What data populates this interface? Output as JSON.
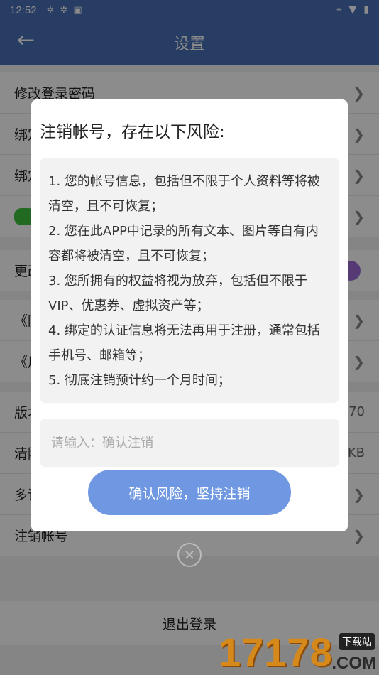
{
  "status_bar": {
    "time": "12:52",
    "icons": [
      "sync-icon",
      "sync-icon",
      "a-icon"
    ],
    "right_icons": [
      "location-icon",
      "wifi-icon",
      "battery-icon"
    ]
  },
  "app_bar": {
    "title": "设置",
    "back_icon": "arrow-left-icon"
  },
  "settings": {
    "group1": [
      {
        "label": "修改登录密码"
      },
      {
        "label": "绑定"
      },
      {
        "label": "绑定"
      },
      {
        "label": ""
      }
    ],
    "group2": [
      {
        "label": "更改"
      }
    ],
    "group3": [
      {
        "label": "《隐"
      },
      {
        "label": "《用"
      }
    ],
    "group4": [
      {
        "label": "版本",
        "value": "70"
      },
      {
        "label": "清除",
        "value": "KB"
      },
      {
        "label": "多语",
        "value": ""
      },
      {
        "label": "注销帐号",
        "value": ""
      }
    ],
    "logout": "退出登录"
  },
  "dialog": {
    "title": "注销帐号，存在以下风险:",
    "risks": [
      "1. 您的帐号信息，包括但不限于个人资料等将被清空，且不可恢复；",
      "2. 您在此APP中记录的所有文本、图片等自有内容都将被清空，且不可恢复；",
      "3. 您所拥有的权益将视为放弃，包括但不限于VIP、优惠券、虚拟资产等；",
      "4. 绑定的认证信息将无法再用于注册，通常包括手机号、邮箱等；",
      "5. 彻底注销预计约一个月时间；"
    ],
    "input_placeholder": "请输入：确认注销",
    "input_value": "",
    "confirm_label": "确认风险，坚持注销"
  },
  "watermark": {
    "number": "17178",
    "tag": "下载站",
    "suffix": ".COM"
  },
  "colors": {
    "app_bar": "#4a6fb5",
    "confirm_button": "#6f97e2",
    "toggle": "#9c6ad8"
  }
}
